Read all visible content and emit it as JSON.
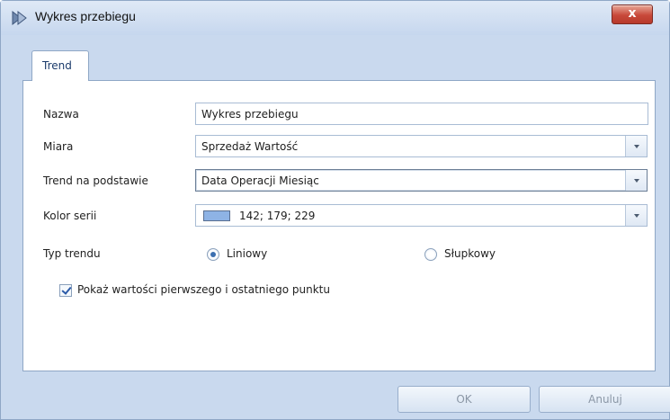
{
  "window": {
    "title": "Wykres przebiegu",
    "close_glyph": "x"
  },
  "tabs": [
    {
      "label": "Trend"
    }
  ],
  "form": {
    "name": {
      "label": "Nazwa",
      "value": "Wykres przebiegu"
    },
    "measure": {
      "label": "Miara",
      "value": "Sprzedaż Wartość"
    },
    "trend_basis": {
      "label": "Trend na podstawie",
      "value": "Data Operacji Miesiąc"
    },
    "series_color": {
      "label": "Kolor serii",
      "value": "142; 179; 229",
      "swatch_color": "#8eb3e5"
    },
    "trend_type": {
      "label": "Typ trendu",
      "options": [
        "Liniowy",
        "Słupkowy"
      ],
      "selected": "Liniowy"
    },
    "show_points": {
      "label": "Pokaż wartości pierwszego i ostatniego punktu",
      "checked": true
    }
  },
  "buttons": {
    "ok": "OK",
    "cancel": "Anuluj"
  },
  "icons": {
    "app": "chart-app-icon",
    "close": "close-icon",
    "dropdown": "chevron-down-icon"
  }
}
